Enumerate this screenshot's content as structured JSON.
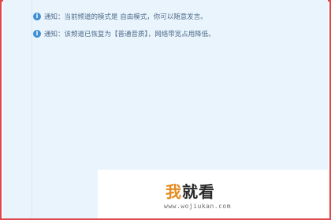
{
  "notices": [
    {
      "icon": "info-icon",
      "text": "通知：当前频道的模式是 自由模式，你可以随意发言。"
    },
    {
      "icon": "info-icon",
      "text": "通知：该频道已恢复为【普通音质】，网络带宽占用降低。"
    }
  ],
  "watermark": {
    "logo_char1": "我",
    "logo_rest": "就看",
    "url": "www.wojiukan.com"
  },
  "colors": {
    "border": "#e0474c",
    "panel_bg": "#eaf4fc",
    "info_icon": "#3f8fd4",
    "notice_text": "#4f6d8c",
    "logo_accent": "#e58a1f"
  }
}
